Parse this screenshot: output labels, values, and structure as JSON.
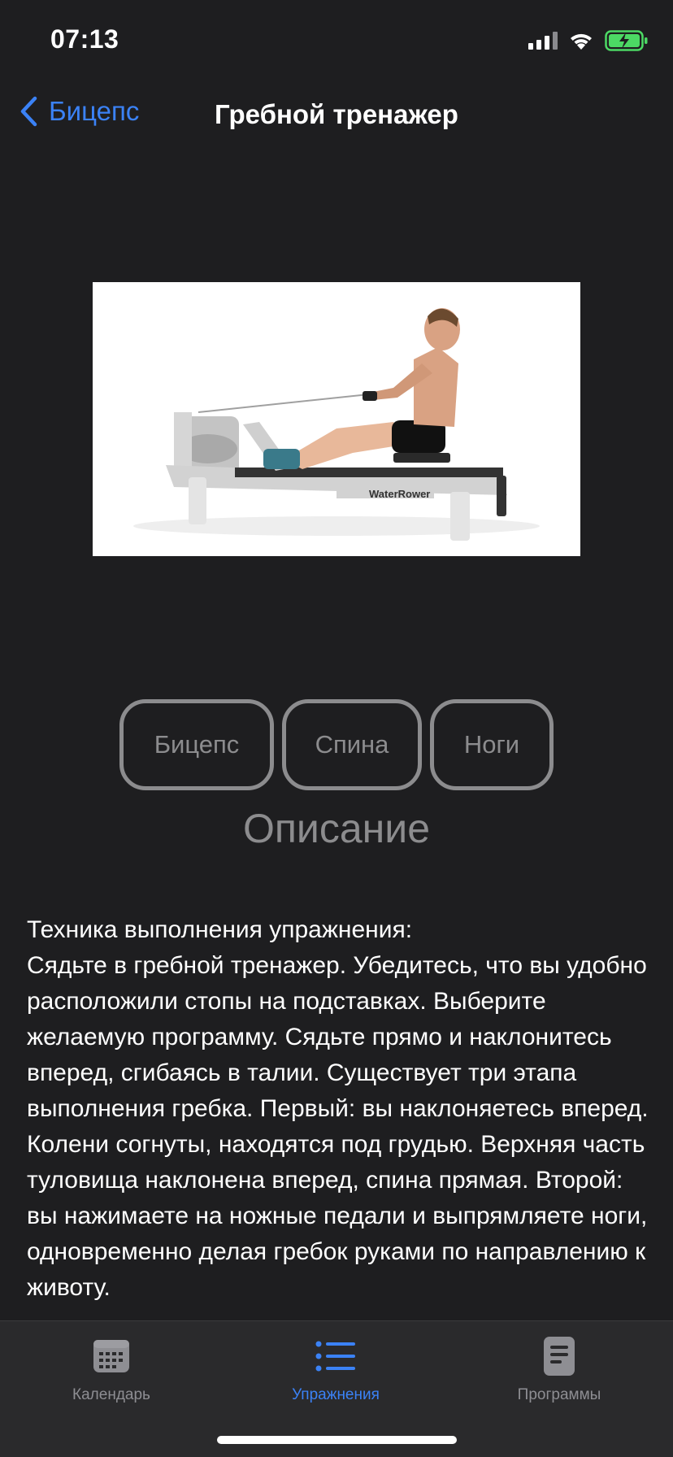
{
  "status": {
    "time": "07:13"
  },
  "nav": {
    "back_label": "Бицепс",
    "title": "Гребной тренажер"
  },
  "image": {
    "brand_text": "WaterRower"
  },
  "tags": [
    "Бицепс",
    "Спина",
    "Ноги"
  ],
  "section_title": "Описание",
  "description": "Техника выполнения упражнения:\nСядьте в гребной тренажер. Убедитесь, что вы удобно расположили стопы на подставках. Выберите желаемую программу. Сядьте прямо и наклонитесь вперед, сгибаясь в талии. Существует три этапа выполнения гребка. Первый: вы наклоняетесь вперед. Колени согнуты, находятся под грудью. Верхняя часть туловища наклонена вперед, спина прямая. Второй: вы нажимаете на ножные педали и выпрямляете ноги, одновременно делая гребок руками по направлению к животу.",
  "tabs": [
    {
      "label": "Календарь",
      "icon": "calendar-icon",
      "active": false
    },
    {
      "label": "Упражнения",
      "icon": "list-icon",
      "active": true
    },
    {
      "label": "Программы",
      "icon": "document-icon",
      "active": false
    }
  ],
  "colors": {
    "background": "#1e1e20",
    "accent": "#3b82f6",
    "muted": "#8c8c8e",
    "tab_bar": "#2a2a2c",
    "battery": "#4cd964"
  }
}
